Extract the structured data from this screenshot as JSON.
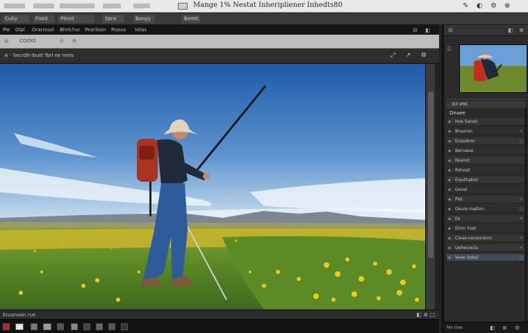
{
  "window": {
    "title": "Mange 1% Nestat Inheripliener Inhedts80",
    "controls": [
      "✎",
      "◐",
      "⚙",
      "⊗"
    ]
  },
  "tabs": [
    "Cuhy",
    "Flatd",
    "Pilnrd",
    "Spra",
    "Banyy",
    "Bemtl"
  ],
  "menu": {
    "items": [
      "Pie",
      "Olpl",
      "Orarroud",
      "Bhrlchur",
      "Pearloan",
      "Ropus",
      "Iotas"
    ],
    "icons": [
      "⊟",
      "◧"
    ]
  },
  "toolbar1": {
    "items": [
      "◎",
      "COOIO",
      "⊙",
      "⊘"
    ]
  },
  "toolbar2": {
    "path": "⊝ · Secrdlt-Ibutt TorI ee Inels",
    "icons": [
      "⤢",
      "↗",
      "⚙"
    ]
  },
  "status": {
    "label": "Eruanaan rue",
    "controls": [
      "◧",
      "⊗",
      "□"
    ]
  },
  "right_panel": {
    "header_icons": [
      "⊟",
      "◧",
      "⊗"
    ],
    "nav_icon": "☰",
    "tab_label": "B3 VNS",
    "props_title": "Dnaee",
    "layers": [
      {
        "name": "Hoe Sandn",
        "end": ""
      },
      {
        "name": "Bnaoren",
        "end": "+"
      },
      {
        "name": "Enlaabrer",
        "end": "▢"
      },
      {
        "name": "Benuaoe",
        "end": ""
      },
      {
        "name": "Reanot",
        "end": ""
      },
      {
        "name": "Rdnoat",
        "end": ""
      },
      {
        "name": "Eiauthabsn",
        "end": ""
      },
      {
        "name": "Genal",
        "end": ""
      },
      {
        "name": "Piel",
        "end": "+"
      },
      {
        "name": "Ooure roatton",
        "end": "▢"
      },
      {
        "name": "Ee",
        "end": "+"
      },
      {
        "name": "Elnrn Foet",
        "end": ""
      },
      {
        "name": "Cleae-neceuranrs",
        "end": "+"
      },
      {
        "name": "Uehwuecla",
        "end": "+"
      },
      {
        "name": "Veoe Sobul",
        "end": "▢"
      }
    ],
    "footer_label": "Mn Oee",
    "footer_icons": [
      "◧",
      "⊗",
      "⚙"
    ]
  },
  "colors": {
    "sky_top": "#1f5fae",
    "sky_bottom": "#cfe2f2",
    "grass": "#5d8a2a",
    "flowers": "#e8c21e",
    "jacket": "#1f2a3a",
    "backpack": "#a8331f",
    "jeans": "#2f5a9a"
  }
}
